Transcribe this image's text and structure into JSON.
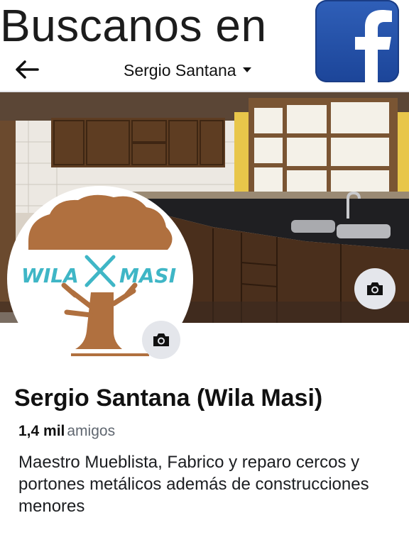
{
  "promo": {
    "title": "Buscanos en",
    "logo_letter": "f"
  },
  "topbar": {
    "back_icon": "arrow-left-icon",
    "title": "Sergio Santana",
    "dropdown_icon": "caret-down-icon"
  },
  "cover": {
    "camera_icon": "camera-icon"
  },
  "avatar": {
    "logo_text_left": "WILA",
    "logo_text_right": "MASI",
    "camera_icon": "camera-icon"
  },
  "profile": {
    "name": "Sergio Santana (Wila Masi)",
    "friends_count": "1,4 mil",
    "friends_label": "amigos",
    "bio": "Maestro Mueblista, Fabrico y reparo cercos y portones metálicos además de construcciones menores"
  },
  "colors": {
    "facebook_blue": "#1c4599",
    "logo_brown": "#b0703f",
    "logo_teal": "#3fb6c6"
  }
}
